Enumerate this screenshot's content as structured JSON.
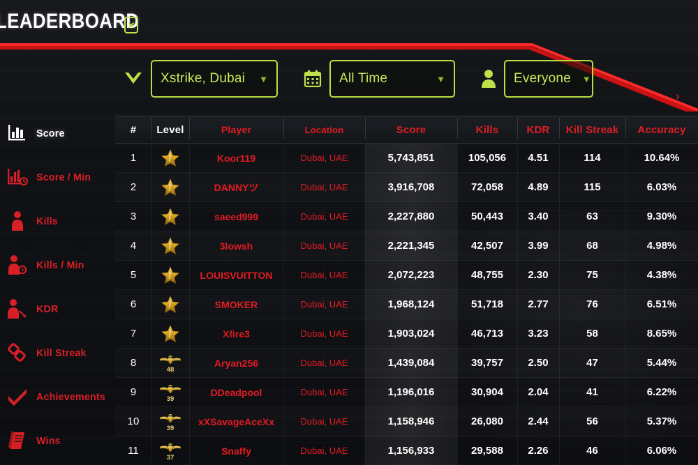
{
  "header": {
    "title": "LEADERBOARD",
    "badge_icon": "x-badge-icon",
    "badge_glyph": "✕"
  },
  "filters": [
    {
      "icon": "chevron-v-icon",
      "label": "Xstrike, Dubai",
      "caret": "▼"
    },
    {
      "icon": "calendar-icon",
      "label": "All Time",
      "caret": "▼"
    },
    {
      "icon": "person-icon",
      "label": "Everyone",
      "caret": "▼"
    }
  ],
  "next_page_chevron": "›",
  "sidebar": {
    "items": [
      {
        "label": "Score",
        "icon": "bar-chart-icon",
        "active": true
      },
      {
        "label": "Score / Min",
        "icon": "bar-chart-clock-icon",
        "active": false
      },
      {
        "label": "Kills",
        "icon": "person-icon",
        "active": false
      },
      {
        "label": "Kills / Min",
        "icon": "person-clock-icon",
        "active": false
      },
      {
        "label": "KDR",
        "icon": "person-arrow-icon",
        "active": false
      },
      {
        "label": "Kill Streak",
        "icon": "chain-links-icon",
        "active": false
      },
      {
        "label": "Achievements",
        "icon": "checkmark-icon",
        "active": false
      },
      {
        "label": "Wins",
        "icon": "book-icon",
        "active": false
      }
    ]
  },
  "table": {
    "columns": [
      {
        "key": "rank",
        "label": "#",
        "color": "white"
      },
      {
        "key": "level",
        "label": "Level",
        "color": "white"
      },
      {
        "key": "player",
        "label": "Player",
        "color": "white"
      },
      {
        "key": "loc",
        "label": "Location",
        "color": "white"
      },
      {
        "key": "score",
        "label": "Score",
        "color": "red"
      },
      {
        "key": "kills",
        "label": "Kills",
        "color": "red"
      },
      {
        "key": "kdr",
        "label": "KDR",
        "color": "red"
      },
      {
        "key": "ks",
        "label": "Kill Streak",
        "color": "red"
      },
      {
        "key": "acc",
        "label": "Accuracy",
        "color": "red"
      }
    ],
    "sorted_by": "Score",
    "rows": [
      {
        "rank": "1",
        "badge": "star",
        "badge_num": "",
        "player": "Koor119",
        "loc": "Dubai, UAE",
        "score": "5,743,851",
        "kills": "105,056",
        "kdr": "4.51",
        "ks": "114",
        "acc": "10.64%"
      },
      {
        "rank": "2",
        "badge": "star",
        "badge_num": "",
        "player": "DANNYツ",
        "loc": "Dubai, UAE",
        "score": "3,916,708",
        "kills": "72,058",
        "kdr": "4.89",
        "ks": "115",
        "acc": "6.03%"
      },
      {
        "rank": "3",
        "badge": "star",
        "badge_num": "",
        "player": "saeed999",
        "loc": "Dubai, UAE",
        "score": "2,227,880",
        "kills": "50,443",
        "kdr": "3.40",
        "ks": "63",
        "acc": "9.30%"
      },
      {
        "rank": "4",
        "badge": "star",
        "badge_num": "",
        "player": "3lowsh",
        "loc": "Dubai, UAE",
        "score": "2,221,345",
        "kills": "42,507",
        "kdr": "3.99",
        "ks": "68",
        "acc": "4.98%"
      },
      {
        "rank": "5",
        "badge": "star",
        "badge_num": "",
        "player": "LOUISVUITTON",
        "loc": "Dubai, UAE",
        "score": "2,072,223",
        "kills": "48,755",
        "kdr": "2.30",
        "ks": "75",
        "acc": "4.38%"
      },
      {
        "rank": "6",
        "badge": "star",
        "badge_num": "",
        "player": "SMOKER",
        "loc": "Dubai, UAE",
        "score": "1,968,124",
        "kills": "51,718",
        "kdr": "2.77",
        "ks": "76",
        "acc": "6.51%"
      },
      {
        "rank": "7",
        "badge": "star",
        "badge_num": "",
        "player": "Xfire3",
        "loc": "Dubai, UAE",
        "score": "1,903,024",
        "kills": "46,713",
        "kdr": "3.23",
        "ks": "58",
        "acc": "8.65%"
      },
      {
        "rank": "8",
        "badge": "eagle",
        "badge_num": "48",
        "player": "Aryan256",
        "loc": "Dubai, UAE",
        "score": "1,439,084",
        "kills": "39,757",
        "kdr": "2.50",
        "ks": "47",
        "acc": "5.44%"
      },
      {
        "rank": "9",
        "badge": "eagle",
        "badge_num": "39",
        "player": "DDeadpool",
        "loc": "Dubai, UAE",
        "score": "1,196,016",
        "kills": "30,904",
        "kdr": "2.04",
        "ks": "41",
        "acc": "6.22%"
      },
      {
        "rank": "10",
        "badge": "eagle",
        "badge_num": "39",
        "player": "xXSavageAceXx",
        "loc": "Dubai, UAE",
        "score": "1,158,946",
        "kills": "26,080",
        "kdr": "2.44",
        "ks": "56",
        "acc": "5.37%"
      },
      {
        "rank": "11",
        "badge": "eagle",
        "badge_num": "37",
        "player": "Snaffy",
        "loc": "Dubai, UAE",
        "score": "1,156,933",
        "kills": "29,588",
        "kdr": "2.26",
        "ks": "46",
        "acc": "6.06%"
      }
    ]
  },
  "colors": {
    "accent_red": "#e31b23",
    "accent_green": "#bfe04a",
    "gold": "#e8b23a",
    "background": "#0e1014"
  }
}
